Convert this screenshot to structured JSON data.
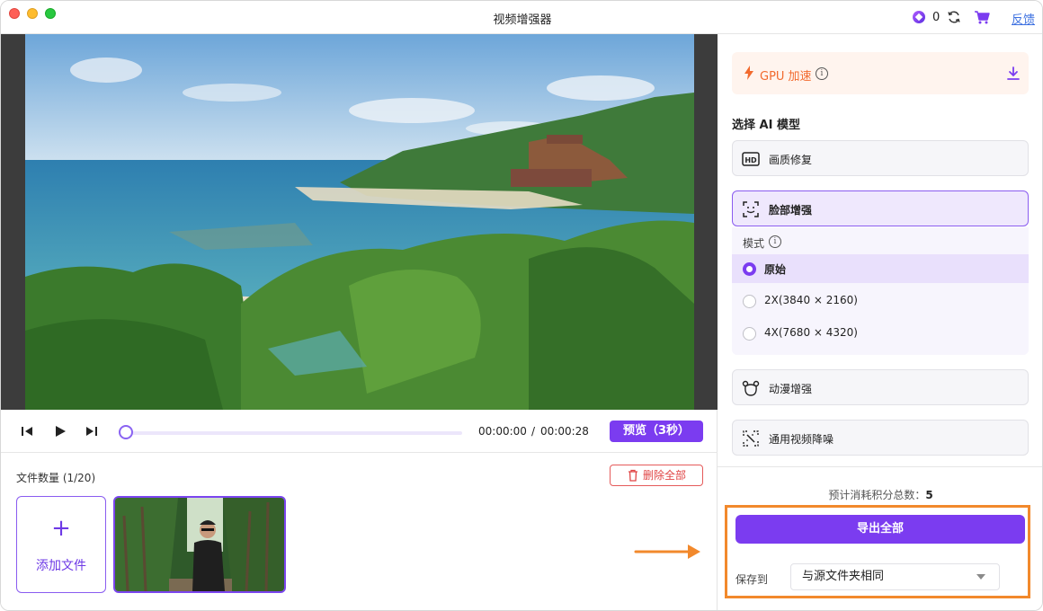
{
  "window": {
    "title": "视频增强器",
    "credits": "0",
    "feedback_label": "反馈"
  },
  "player": {
    "current_time": "00:00:00",
    "separator": "/",
    "total_time": "00:00:28",
    "progress": 0,
    "preview_label": "预览（3秒）"
  },
  "files": {
    "count_label": "文件数量 (1/20)",
    "delete_all_label": "删除全部",
    "add_file_label": "添加文件",
    "add_symbol": "+"
  },
  "settings": {
    "gpu_label": "GPU 加速",
    "model_section_title": "选择 AI 模型",
    "models": [
      {
        "label": "画质修复",
        "icon": "hd-icon"
      },
      {
        "label": "脸部增强",
        "icon": "face-scan-icon",
        "selected": true
      },
      {
        "label": "动漫增强",
        "icon": "anime-bear-icon"
      },
      {
        "label": "通用视频降噪",
        "icon": "denoise-icon"
      }
    ],
    "mode_label": "模式",
    "modes": [
      {
        "label": "原始",
        "selected": true
      },
      {
        "label": "2X(3840 × 2160)",
        "selected": false
      },
      {
        "label": "4X(7680 × 4320)",
        "selected": false
      }
    ]
  },
  "export": {
    "estimate_label": "预计消耗积分总数：",
    "estimate_value": "5",
    "export_all_label": "导出全部",
    "save_to_label": "保存到",
    "save_to_value": "与源文件夹相同"
  },
  "colors": {
    "accent": "#7b3cf0",
    "annotation": "#f2892c",
    "gpu_text": "#f26a2e",
    "danger": "#e04545"
  }
}
